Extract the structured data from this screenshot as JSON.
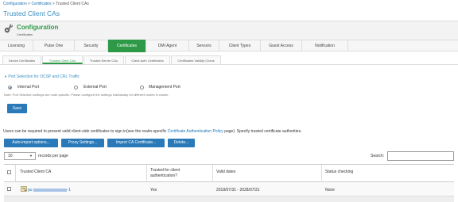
{
  "breadcrumb": {
    "items": [
      "Configuration",
      "Certificates",
      "Trusted Client CAs"
    ],
    "separator": ">"
  },
  "page_title": "Trusted Client CAs",
  "config": {
    "title": "Configuration",
    "subtitle": "Certificates",
    "icon": "wrench-gear-icon"
  },
  "main_tabs": [
    {
      "label": "Licensing"
    },
    {
      "label": "Pulse One"
    },
    {
      "label": "Security"
    },
    {
      "label": "Certificates",
      "active": true
    },
    {
      "label": "DMI Agent"
    },
    {
      "label": "Sensors"
    },
    {
      "label": "Client Types"
    },
    {
      "label": "Guest Access"
    },
    {
      "label": "Notification"
    }
  ],
  "sub_tabs": [
    {
      "label": "Device Certificates"
    },
    {
      "label": "Trusted Client CAs",
      "active": true
    },
    {
      "label": "Trusted Server CAs"
    },
    {
      "label": "Client Auth Certificates"
    },
    {
      "label": "Certificates Validity Check"
    }
  ],
  "section": {
    "title": "Port Selection for OCSP and CRL Traffic",
    "toggle_icon": "caret-down-icon",
    "radios": [
      {
        "label": "Internal Port",
        "checked": true
      },
      {
        "label": "External Port",
        "checked": false
      },
      {
        "label": "Management Port",
        "checked": false
      }
    ],
    "note": "Note: Port Selection settings are node-specific. Please configure the settings individually for different nodes in cluster.",
    "save_label": "Save"
  },
  "intro": {
    "before": "Users can be required to present valid client-side certificates to sign in(see the realm-specific ",
    "link": "Certificate Authentication Policy",
    "after": " page). Specify trusted certificate authorities."
  },
  "actions": [
    "Auto-import options...",
    "Proxy Settings...",
    "Import CA Certificate...",
    "Delete..."
  ],
  "table_controls": {
    "length_value": "10",
    "length_label": "records per page",
    "search_label": "Search:"
  },
  "table": {
    "headers": [
      "Trusted Client CA",
      "Trusted for client authentication?",
      "Valid dates",
      "Status checking"
    ],
    "rows": [
      {
        "name_prefix": "pu",
        "name_suffix": "-1",
        "trusted": "Yes",
        "valid": "2018/07/31 - 2028/07/31",
        "status": "None"
      }
    ]
  },
  "colors": {
    "accent_green": "#2e9a47",
    "button_blue": "#2a7ab9",
    "link_blue": "#1a73b5"
  }
}
